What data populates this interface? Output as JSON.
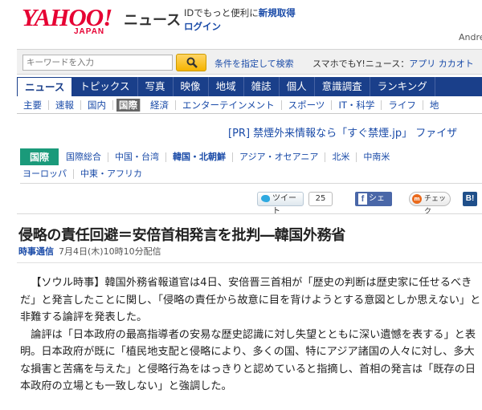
{
  "header": {
    "logo_main": "YAHOO!",
    "logo_sub": "JAPAN",
    "section": "ニュース",
    "promo_text": "IDでもっと便利に",
    "promo_link": "新規取得",
    "login": "ログイン",
    "user": "Andre"
  },
  "search": {
    "placeholder": "キーワードを入力",
    "advanced": "条件を指定して検索",
    "mobile_text": "スマホでもY!ニュース：",
    "mobile_links": "アプリ  カカオト"
  },
  "main_nav": [
    "ニュース",
    "トピックス",
    "写真",
    "映像",
    "地域",
    "雑誌",
    "個人",
    "意識調査",
    "ランキング"
  ],
  "sub_nav": [
    "主要",
    "速報",
    "国内",
    "国際",
    "経済",
    "エンターテインメント",
    "スポーツ",
    "IT・科学",
    "ライフ",
    "地"
  ],
  "pr": {
    "label": "[PR]",
    "text": "禁煙外来情報なら「すぐ禁煙.jp」 ファイザ"
  },
  "category": {
    "label": "国際",
    "row1": [
      "国際総合",
      "中国・台湾",
      "韓国・北朝鮮",
      "アジア・オセアニア",
      "北米",
      "中南米"
    ],
    "row2": [
      "ヨーロッパ",
      "中東・アフリカ"
    ]
  },
  "social": {
    "tweet": "ツイート",
    "tweet_count": "25",
    "share": "シェア",
    "check": "チェック",
    "b": "B!"
  },
  "article": {
    "headline": "侵略の責任回避＝安倍首相発言を批判―韓国外務省",
    "source": "時事通信",
    "time": "7月4日(木)10時10分配信",
    "paragraphs": [
      "【ソウル時事】韓国外務省報道官は4日、安倍晋三首相が「歴史の判断は歴史家に任せるべきだ」と発言したことに関し、「侵略の責任から故意に目を背けようとする意図としか思えない」と非難する論評を発表した。",
      "論評は「日本政府の最高指導者の安易な歴史認識に対し失望とともに深い遺憾を表する」と表明。日本政府が既に「植民地支配と侵略により、多くの国、特にアジア諸国の人々に対し、多大な損害と苦痛を与えた」と侵略行為をはっきりと認めていると指摘し、首相の発言は「既存の日本政府の立場とも一致しない」と強調した。"
    ]
  }
}
